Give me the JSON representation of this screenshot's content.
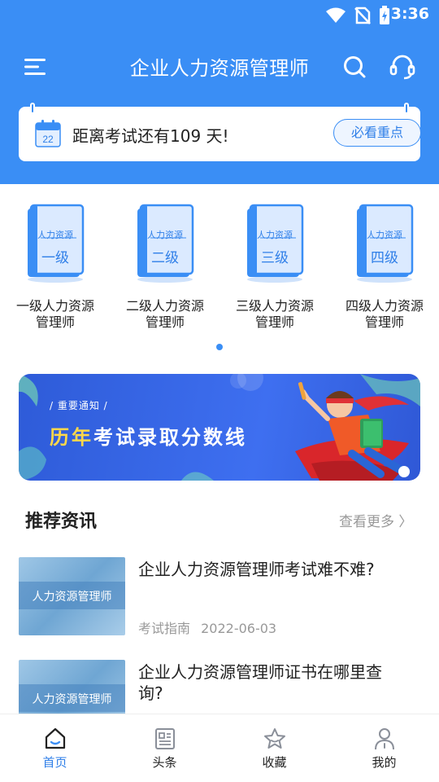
{
  "status_bar": {
    "time": "3:36"
  },
  "header": {
    "title": "企业人力资源管理师",
    "countdown_day": "22",
    "countdown_text": "距离考试还有109 天!",
    "must_see_label": "必看重点"
  },
  "levels": [
    {
      "book_top": "人力资源",
      "book_level": "一级",
      "label": "一级人力资源管理师"
    },
    {
      "book_top": "人力资源",
      "book_level": "二级",
      "label": "二级人力资源管理师"
    },
    {
      "book_top": "人力资源",
      "book_level": "三级",
      "label": "三级人力资源管理师"
    },
    {
      "book_top": "人力资源",
      "book_level": "四级",
      "label": "四级人力资源管理师"
    }
  ],
  "banner": {
    "kicker": "/ 重要通知 /",
    "title_highlight": "历年",
    "title_rest": "考试录取分数线"
  },
  "section": {
    "title": "推荐资讯",
    "more": "查看更多 〉"
  },
  "articles": [
    {
      "thumb_text": "人力资源管理师",
      "title": "企业人力资源管理师考试难不难?",
      "category": "考试指南",
      "date": "2022-06-03"
    },
    {
      "thumb_text": "人力资源管理师",
      "title": "企业人力资源管理师证书在哪里查询?"
    }
  ],
  "bottom_nav": [
    {
      "label": "首页",
      "icon": "home-icon",
      "active": true
    },
    {
      "label": "头条",
      "icon": "news-icon",
      "active": false
    },
    {
      "label": "收藏",
      "icon": "star-icon",
      "active": false
    },
    {
      "label": "我的",
      "icon": "user-icon",
      "active": false
    }
  ],
  "colors": {
    "primary": "#3a8ef5",
    "highlight": "#ffd84a",
    "muted": "#999999"
  }
}
